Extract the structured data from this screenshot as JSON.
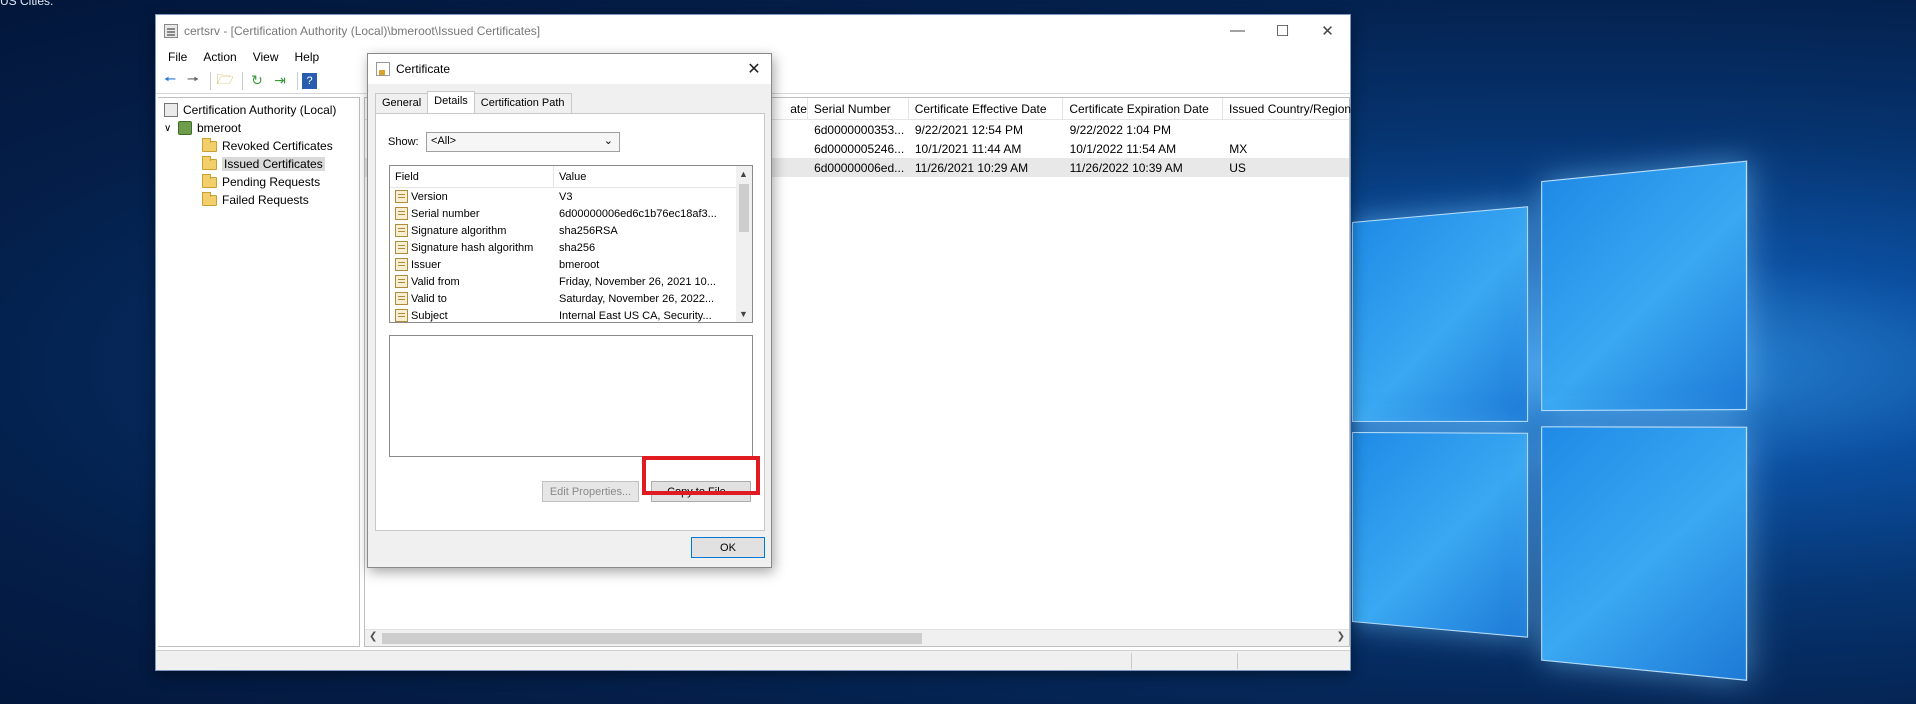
{
  "desktop": {
    "corner_text": "US Cities."
  },
  "mmc": {
    "title": "certsrv - [Certification Authority (Local)\\bmeroot\\Issued Certificates]",
    "menu": [
      "File",
      "Action",
      "View",
      "Help"
    ],
    "tree": {
      "root": "Certification Authority (Local)",
      "server": "bmeroot",
      "folders": [
        "Revoked Certificates",
        "Issued Certificates",
        "Pending Requests",
        "Failed Requests"
      ],
      "selected": "Issued Certificates"
    },
    "list": {
      "columns": [
        "ate",
        "Serial Number",
        "Certificate Effective Date",
        "Certificate Expiration Date",
        "Issued Country/Region"
      ],
      "rows": [
        [
          "",
          "6d0000000353...",
          "9/22/2021 12:54 PM",
          "9/22/2022 1:04 PM",
          ""
        ],
        [
          "",
          "6d0000005246...",
          "10/1/2021 11:44 AM",
          "10/1/2022 11:54 AM",
          "MX"
        ],
        [
          "",
          "6d00000006ed...",
          "11/26/2021 10:29 AM",
          "11/26/2022 10:39 AM",
          "US"
        ]
      ]
    }
  },
  "dialog": {
    "title": "Certificate",
    "tabs": [
      "General",
      "Details",
      "Certification Path"
    ],
    "active_tab": "Details",
    "show_label": "Show:",
    "show_value": "<All>",
    "fields_header": [
      "Field",
      "Value"
    ],
    "fields": [
      [
        "Version",
        "V3"
      ],
      [
        "Serial number",
        "6d00000006ed6c1b76ec18af3..."
      ],
      [
        "Signature algorithm",
        "sha256RSA"
      ],
      [
        "Signature hash algorithm",
        "sha256"
      ],
      [
        "Issuer",
        "bmeroot"
      ],
      [
        "Valid from",
        "Friday, November 26, 2021 10..."
      ],
      [
        "Valid to",
        "Saturday, November 26, 2022..."
      ],
      [
        "Subject",
        "Internal East US CA, Security..."
      ]
    ],
    "edit_properties_label": "Edit Properties...",
    "copy_to_file_label": "Copy to File...",
    "ok_label": "OK"
  }
}
